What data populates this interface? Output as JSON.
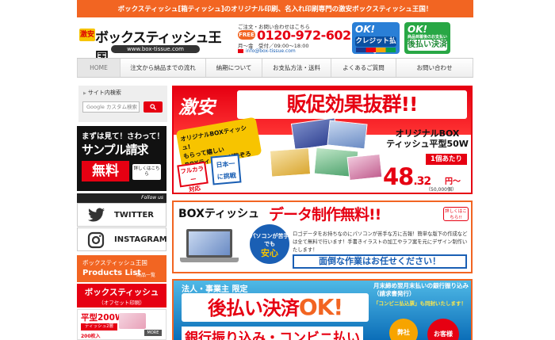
{
  "topbar": {
    "text": "ボックスティッシュ[箱ティッシュ]のオリジナル印刷、名入れ印刷専門の激安ボックスティッシュ王国！"
  },
  "header": {
    "logo_prefix": "激安",
    "logo_name": "ボックスティッシュ王国",
    "logo_url": "www.box-tissue.com",
    "contact_label": "ご注文・お問い合わせはこちら",
    "freedial": "FREE",
    "tel": "0120-972-602",
    "hours": "月〜金　受付／09:00〜18:00",
    "email": "info@box-tissue.com",
    "badge_credit_ok": "OK!",
    "badge_credit_label": "クレジット払い",
    "badge_after_ok": "OK!",
    "badge_after_sub": "商品到着後のお支払い",
    "badge_after_label": "後払い決済"
  },
  "nav": {
    "items": [
      "HOME",
      "注文から納品までの流れ",
      "納期について",
      "お支払方法・送料",
      "よくあるご質問",
      "お問い合わせ"
    ]
  },
  "sidebar": {
    "search_title": "サイト内検索",
    "search_placeholder": "Google カスタム検索",
    "sample_line1": "まずは見て！さわって！",
    "sample_line2": "サンプル請求",
    "sample_free": "無料",
    "sample_more": "詳しくはこちら",
    "follow_us": "Follow us",
    "twitter": "TWITTER",
    "instagram": "INSTAGRAM",
    "products_a": "ボックスティッシュ王国",
    "products_b": "Products List",
    "products_c": "商品一覧",
    "box_a": "ボックスティッシュ",
    "box_b": "（オフセット印刷）",
    "flat_a": "平型200W",
    "flat_b": "ティッシュ2層",
    "flat_c": "200枚入",
    "flat_more": "MORE"
  },
  "banner1": {
    "gekiyasu": "激安",
    "headline": "販促効果抜群!!",
    "badge_lines": [
      "オリジナルBOXティッシュ!",
      "もらって嬉しい",
      "BOXティッシュが勢ぞろい!"
    ],
    "fullcolor": [
      "フルカラー",
      "対応"
    ],
    "japan": [
      "日本一",
      "に挑戦"
    ],
    "product": [
      "オリジナルBOX",
      "ティッシュ平型50W"
    ],
    "per_unit": "1個あたり",
    "price": "48",
    "price_decimal": ".32",
    "yen": "円〜",
    "qty": "（50,000個）"
  },
  "banner2": {
    "left": "BOXティッシュ",
    "headline": "データ制作無料!!",
    "more": "詳しくはこちら!!",
    "circle_top": "パソコンが苦手でも",
    "circle_main": "安心",
    "text": "ロゴデータをお持ちなのにパソコンが苦手な方に吉報！簡単な版下の作成などは全て無料で行います！手書きイラストの加工やラフ案を元にデザイン制作いたします！",
    "bottom": "面倒な作業はお任せください！"
  },
  "banner3": {
    "top": "法人・事業主 限定",
    "headline": "後払い決済",
    "headline_ok": "OK!",
    "right": "月末締め翌月末払いの銀行振り込み（請求書発行）",
    "right_note": "「コンビニ払込票」も同封いたします！",
    "circle1": "弊社",
    "circle2": "お客様",
    "bottom": "銀行振り込み・コンビニ払い"
  }
}
